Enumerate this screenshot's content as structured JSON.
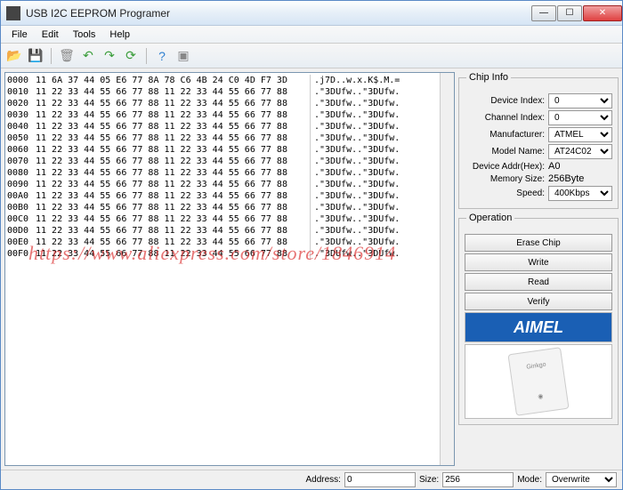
{
  "window": {
    "title": "USB I2C EEPROM Programer"
  },
  "menu": {
    "file": "File",
    "edit": "Edit",
    "tools": "Tools",
    "help": "Help"
  },
  "chipInfo": {
    "title": "Chip Info",
    "deviceIndexLabel": "Device Index:",
    "deviceIndex": "0",
    "channelIndexLabel": "Channel Index:",
    "channelIndex": "0",
    "manufacturerLabel": "Manufacturer:",
    "manufacturer": "ATMEL",
    "modelNameLabel": "Model Name:",
    "modelName": "AT24C02",
    "deviceAddrLabel": "Device Addr(Hex):",
    "deviceAddr": "A0",
    "memorySizeLabel": "Memory Size:",
    "memorySize": "256Byte",
    "speedLabel": "Speed:",
    "speed": "400Kbps"
  },
  "operation": {
    "title": "Operation",
    "erase": "Erase Chip",
    "write": "Write",
    "read": "Read",
    "verify": "Verify"
  },
  "logo": "AIMEL",
  "deviceLabel": "Ginkgo",
  "status": {
    "addressLabel": "Address:",
    "address": "0",
    "sizeLabel": "Size:",
    "size": "256",
    "modeLabel": "Mode:",
    "mode": "Overwrite"
  },
  "watermark": "https://www.aliexpress.com/store/1846914",
  "hexdump": [
    {
      "addr": "0000",
      "bytes": "11 6A 37 44 05 E6 77 8A 78 C6 4B 24 C0 4D F7 3D",
      "ascii": ".j7D..w.x.K$.M.="
    },
    {
      "addr": "0010",
      "bytes": "11 22 33 44 55 66 77 88 11 22 33 44 55 66 77 88",
      "ascii": ".\"3DUfw..\"3DUfw."
    },
    {
      "addr": "0020",
      "bytes": "11 22 33 44 55 66 77 88 11 22 33 44 55 66 77 88",
      "ascii": ".\"3DUfw..\"3DUfw."
    },
    {
      "addr": "0030",
      "bytes": "11 22 33 44 55 66 77 88 11 22 33 44 55 66 77 88",
      "ascii": ".\"3DUfw..\"3DUfw."
    },
    {
      "addr": "0040",
      "bytes": "11 22 33 44 55 66 77 88 11 22 33 44 55 66 77 88",
      "ascii": ".\"3DUfw..\"3DUfw."
    },
    {
      "addr": "0050",
      "bytes": "11 22 33 44 55 66 77 88 11 22 33 44 55 66 77 88",
      "ascii": ".\"3DUfw..\"3DUfw."
    },
    {
      "addr": "0060",
      "bytes": "11 22 33 44 55 66 77 88 11 22 33 44 55 66 77 88",
      "ascii": ".\"3DUfw..\"3DUfw."
    },
    {
      "addr": "0070",
      "bytes": "11 22 33 44 55 66 77 88 11 22 33 44 55 66 77 88",
      "ascii": ".\"3DUfw..\"3DUfw."
    },
    {
      "addr": "0080",
      "bytes": "11 22 33 44 55 66 77 88 11 22 33 44 55 66 77 88",
      "ascii": ".\"3DUfw..\"3DUfw."
    },
    {
      "addr": "0090",
      "bytes": "11 22 33 44 55 66 77 88 11 22 33 44 55 66 77 88",
      "ascii": ".\"3DUfw..\"3DUfw."
    },
    {
      "addr": "00A0",
      "bytes": "11 22 33 44 55 66 77 88 11 22 33 44 55 66 77 88",
      "ascii": ".\"3DUfw..\"3DUfw."
    },
    {
      "addr": "00B0",
      "bytes": "11 22 33 44 55 66 77 88 11 22 33 44 55 66 77 88",
      "ascii": ".\"3DUfw..\"3DUfw."
    },
    {
      "addr": "00C0",
      "bytes": "11 22 33 44 55 66 77 88 11 22 33 44 55 66 77 88",
      "ascii": ".\"3DUfw..\"3DUfw."
    },
    {
      "addr": "00D0",
      "bytes": "11 22 33 44 55 66 77 88 11 22 33 44 55 66 77 88",
      "ascii": ".\"3DUfw..\"3DUfw."
    },
    {
      "addr": "00E0",
      "bytes": "11 22 33 44 55 66 77 88 11 22 33 44 55 66 77 88",
      "ascii": ".\"3DUfw..\"3DUfw."
    },
    {
      "addr": "00F0",
      "bytes": "11 22 33 44 55 66 77 88 11 22 33 44 55 66 77 88",
      "ascii": ".\"3DUfw..\"3DUfw."
    }
  ]
}
